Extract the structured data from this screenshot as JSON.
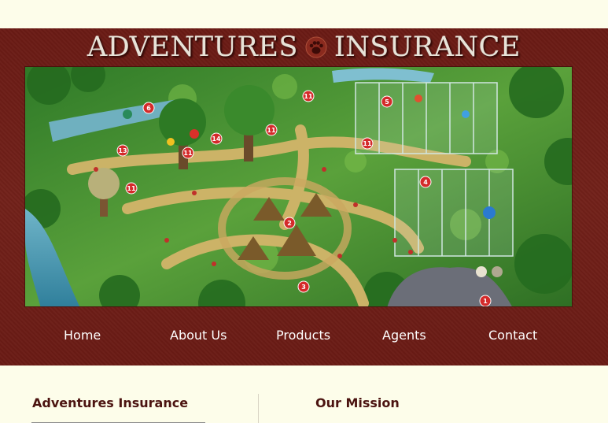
{
  "site": {
    "logo_left": "ADVENTURES",
    "logo_right": "INSURANCE",
    "logo_icon": "paw-icon"
  },
  "nav": {
    "items": [
      {
        "label": "Home"
      },
      {
        "label": "About Us"
      },
      {
        "label": "Products"
      },
      {
        "label": "Agents"
      },
      {
        "label": "Contact"
      }
    ]
  },
  "hero": {
    "image": "illustrated-zoo-park-map",
    "markers": [
      "1",
      "2",
      "3",
      "4",
      "5",
      "6",
      "11",
      "11",
      "11",
      "11",
      "11",
      "11",
      "13",
      "14"
    ]
  },
  "content": {
    "left_title": "Adventures Insurance",
    "right_title": "Our Mission"
  },
  "colors": {
    "header_bg": "#6d1d16",
    "page_bg": "#fdfdea",
    "nav_text": "#ffffff",
    "heading_text": "#4b1310",
    "marker": "#d42a2a"
  }
}
